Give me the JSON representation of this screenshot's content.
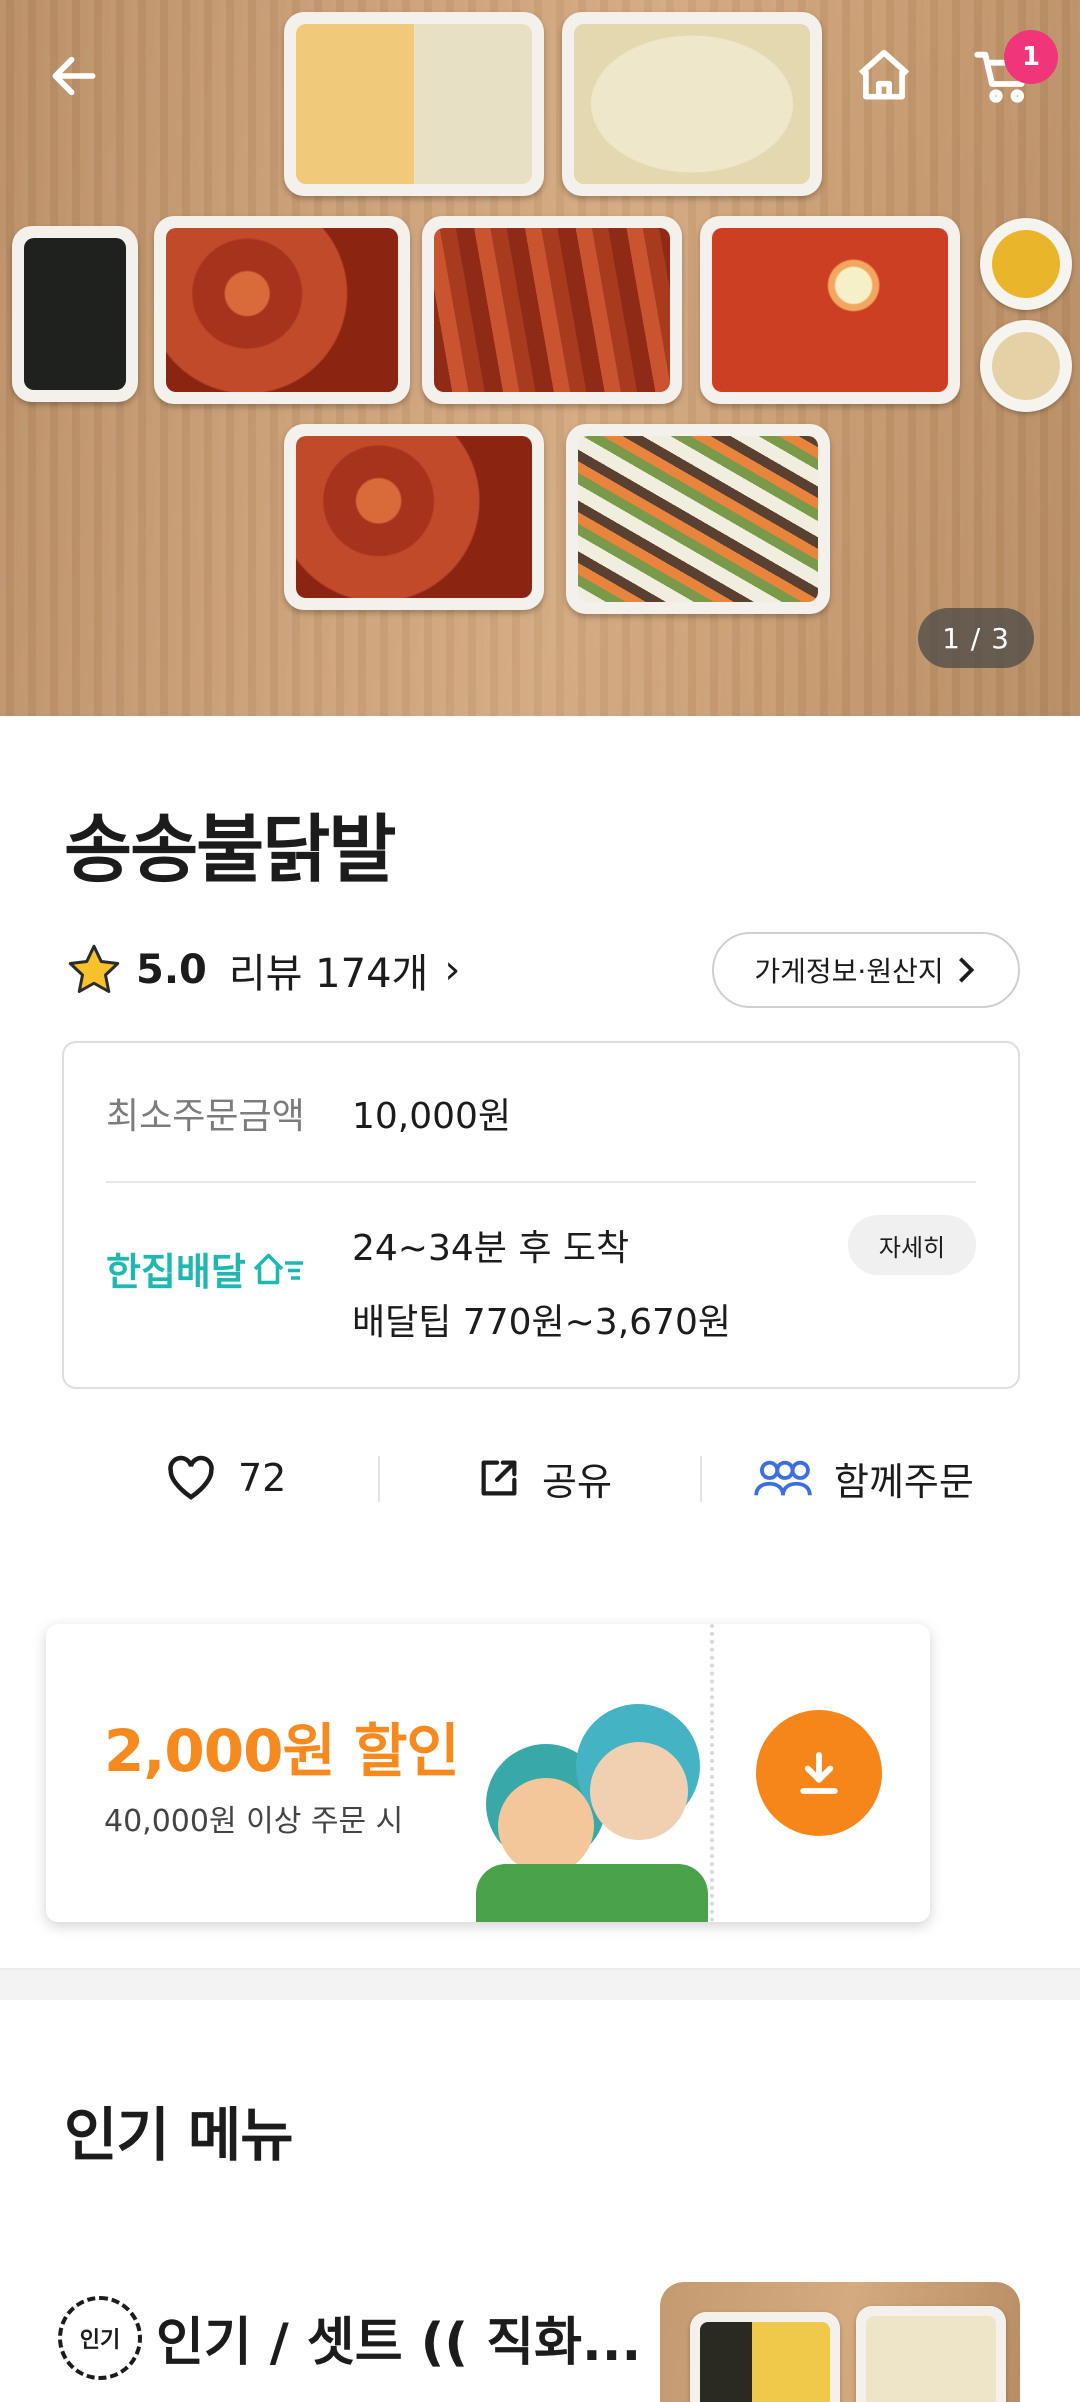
{
  "header": {
    "cart_count": "1",
    "image_indicator": "1 / 3"
  },
  "store": {
    "name": "송송불닭발",
    "rating": "5.0",
    "review_text": "리뷰 174개",
    "info_button": "가게정보·원산지"
  },
  "info": {
    "min_order_label": "최소주문금액",
    "min_order_value": "10,000원",
    "delivery_brand": "한집배달",
    "eta": "24~34분 후 도착",
    "tip": "배달팁 770원~3,670원",
    "detail_button": "자세히"
  },
  "actions": {
    "like_count": "72",
    "share_label": "공유",
    "group_order_label": "함께주문"
  },
  "coupon": {
    "amount": "2,000원 할인",
    "condition": "40,000원 이상 주문 시"
  },
  "popular": {
    "title": "인기 메뉴",
    "badge": "인기",
    "first_item_name": "인기 / 셋트 (( 직화..."
  },
  "colors": {
    "accent_orange": "#f68a1e",
    "delivery_teal": "#1fb8b0",
    "badge_pink": "#f0357a",
    "group_blue": "#3b6fe0"
  }
}
